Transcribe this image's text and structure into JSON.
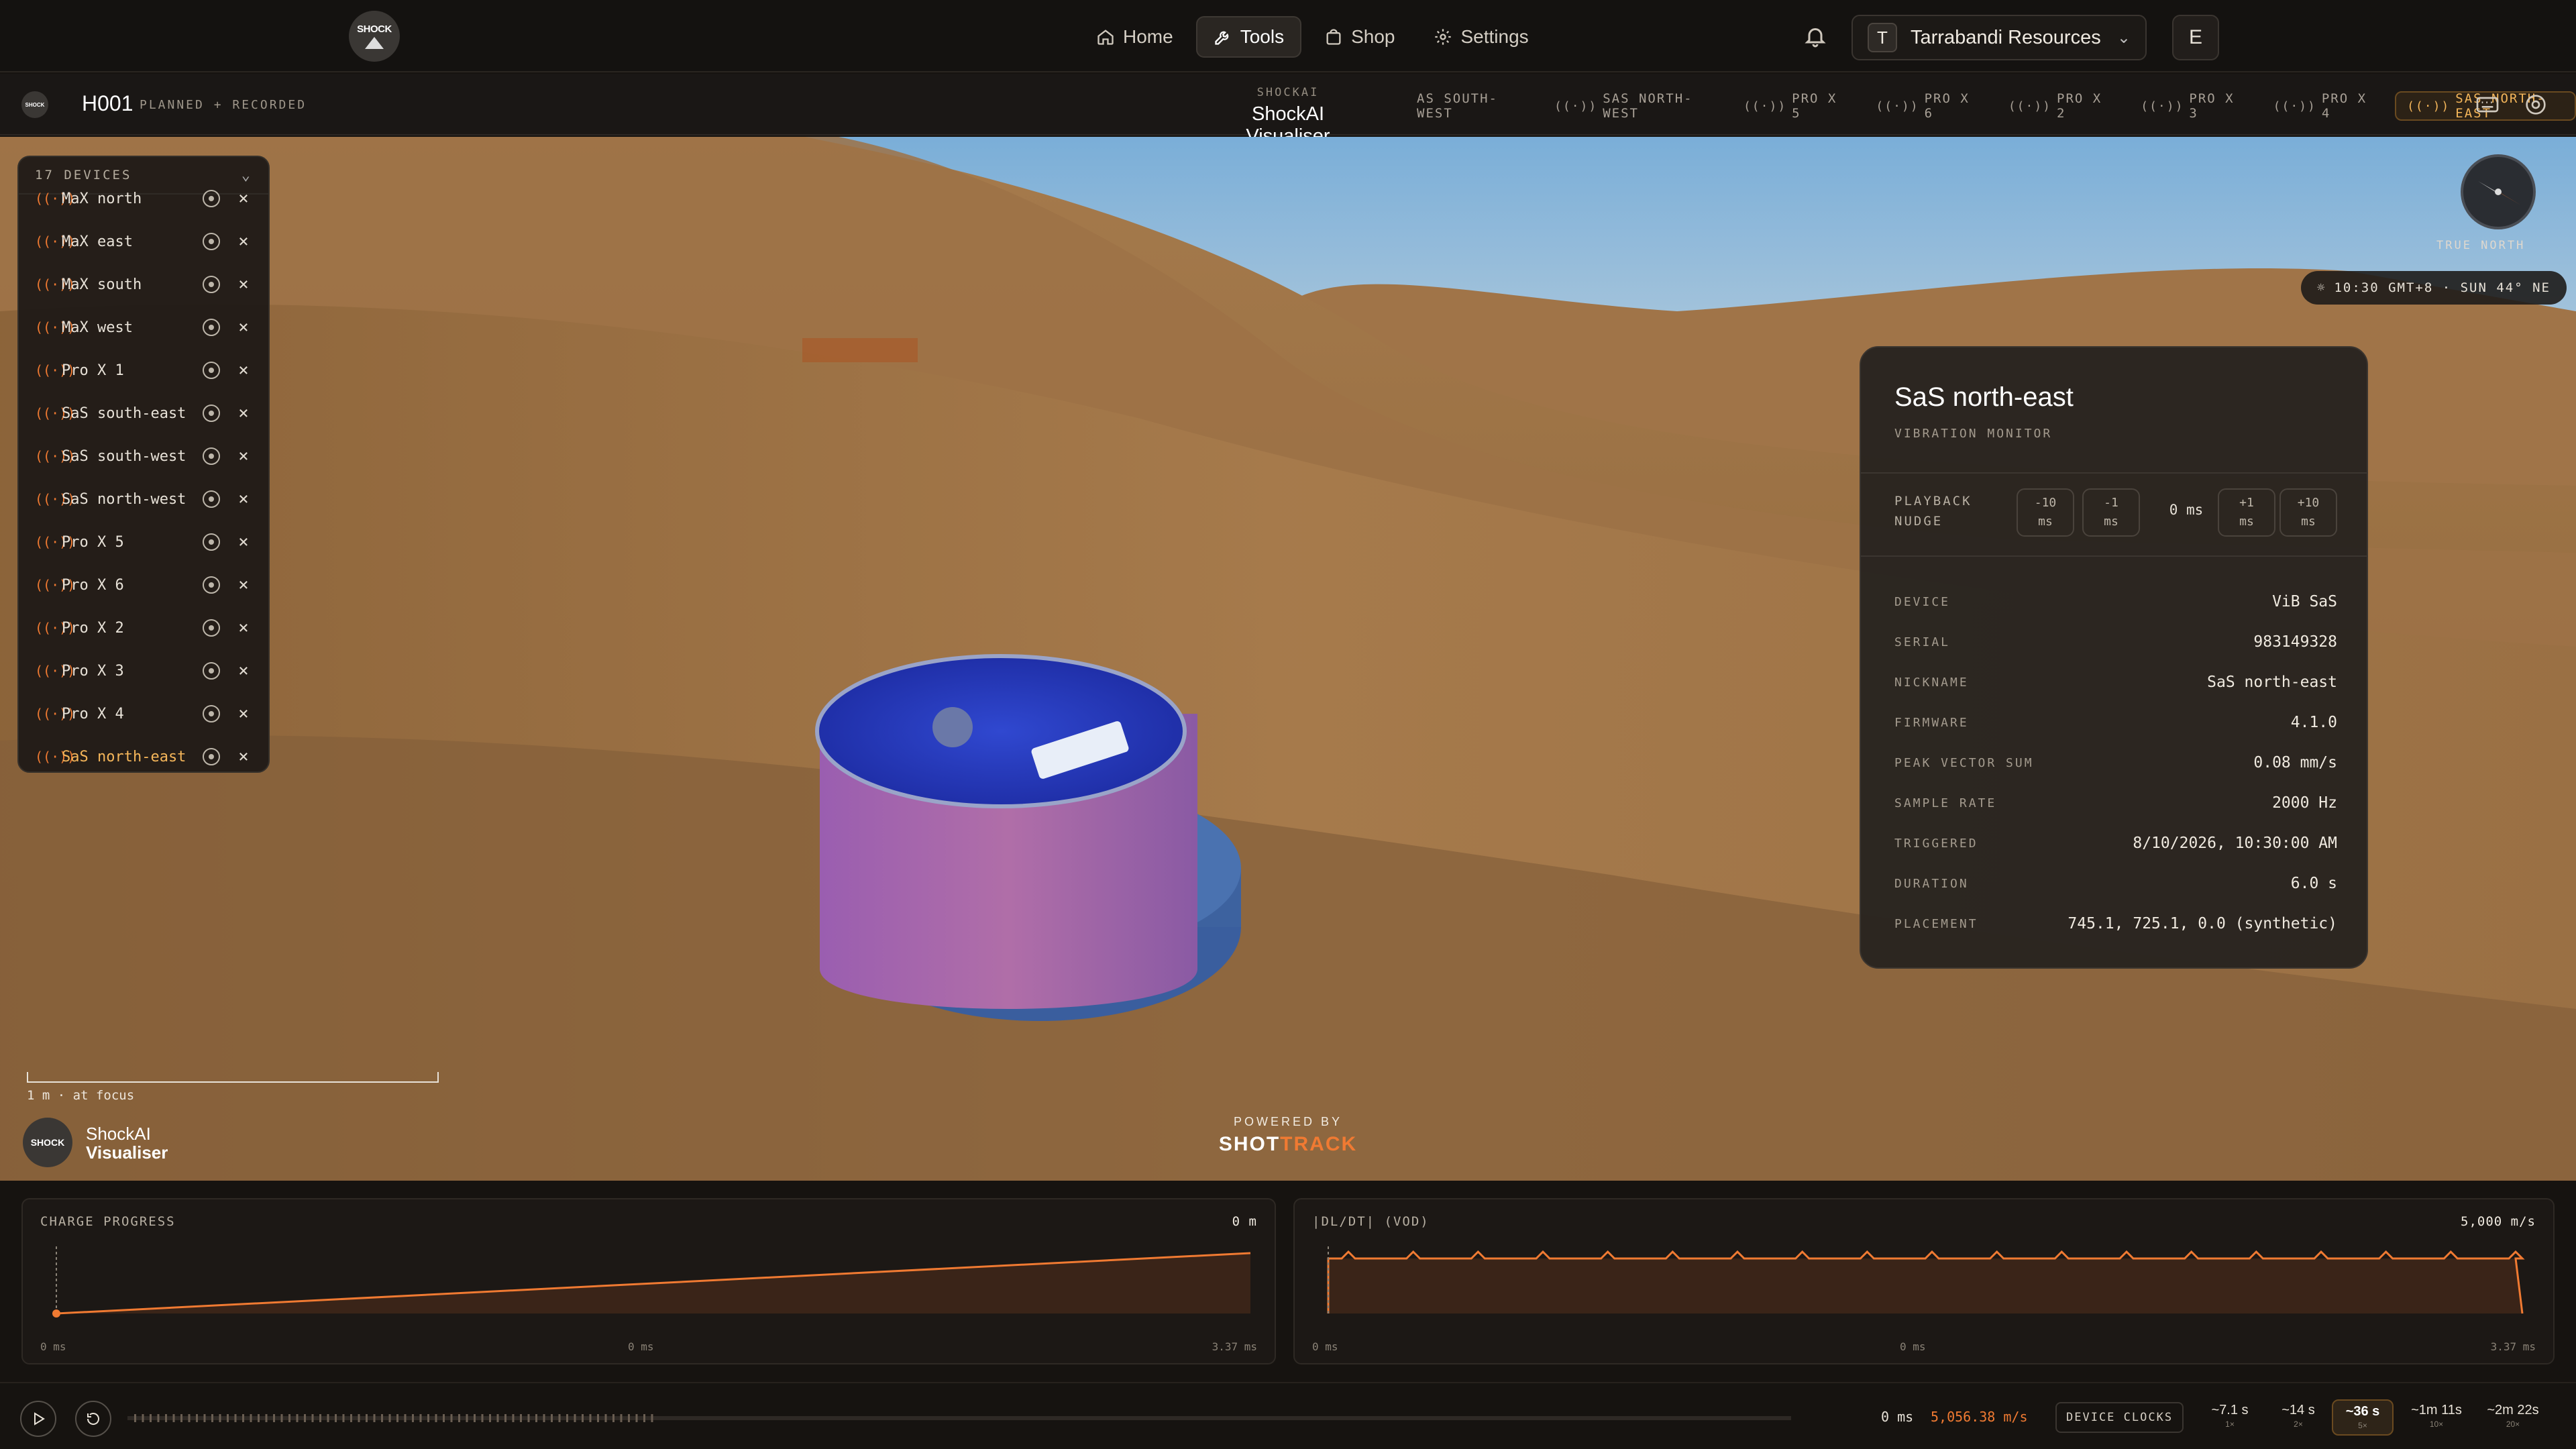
{
  "nav": {
    "logo_text": "SHOCK",
    "links": [
      {
        "label": "Home",
        "icon": "home-icon"
      },
      {
        "label": "Tools",
        "icon": "wrench-icon",
        "active": true
      },
      {
        "label": "Shop",
        "icon": "bag-icon"
      },
      {
        "label": "Settings",
        "icon": "gear-icon"
      }
    ],
    "org": {
      "initial": "T",
      "name": "Tarrabandi Resources"
    },
    "user_initial": "E"
  },
  "subbar": {
    "job_id": "H001",
    "job_status": "PLANNED + RECORDED",
    "app_kicker": "SHOCKAI",
    "app_title": "ShockAI Visualiser",
    "device_tabs": [
      "AS SOUTH-WEST",
      "SAS NORTH-WEST",
      "PRO X 5",
      "PRO X 6",
      "PRO X 2",
      "PRO X 3",
      "PRO X 4",
      "SAS NORTH-EAST"
    ],
    "active_tab": "SAS NORTH-EAST"
  },
  "devices": {
    "header": "17 DEVICES",
    "items": [
      "MaX north",
      "MaX east",
      "MaX south",
      "MaX west",
      "Pro X 1",
      "SaS south-east",
      "SaS south-west",
      "SaS north-west",
      "Pro X 5",
      "Pro X 6",
      "Pro X 2",
      "Pro X 3",
      "Pro X 4",
      "SaS north-east"
    ],
    "active": "SaS north-east"
  },
  "compass": {
    "label": "TRUE NORTH"
  },
  "time_pill": "10:30 GMT+8 · SUN 44° NE",
  "card": {
    "title": "SaS north-east",
    "subtitle": "VIBRATION MONITOR",
    "nudge_label_1": "PLAYBACK",
    "nudge_label_2": "NUDGE",
    "nudge_buttons": [
      {
        "top": "-10",
        "unit": "ms"
      },
      {
        "top": "-1",
        "unit": "ms"
      },
      {
        "top": "+1",
        "unit": "ms"
      },
      {
        "top": "+10",
        "unit": "ms"
      }
    ],
    "nudge_value": "0 ms",
    "fields": [
      {
        "key": "DEVICE",
        "value": "ViB SaS"
      },
      {
        "key": "SERIAL",
        "value": "983149328"
      },
      {
        "key": "NICKNAME",
        "value": "SaS north-east"
      },
      {
        "key": "FIRMWARE",
        "value": "4.1.0"
      },
      {
        "key": "PEAK VECTOR SUM",
        "value": "0.08 mm/s"
      },
      {
        "key": "SAMPLE RATE",
        "value": "2000 Hz"
      },
      {
        "key": "TRIGGERED",
        "value": "8/10/2026, 10:30:00 AM"
      },
      {
        "key": "DURATION",
        "value": "6.0 s"
      },
      {
        "key": "PLACEMENT",
        "value": "745.1, 725.1, 0.0 (synthetic)"
      }
    ]
  },
  "scene": {
    "scale_label": "1 m · at focus",
    "brand_line1": "ShockAI",
    "brand_line2": "Visualiser",
    "powered_by": "POWERED BY",
    "powered_brand_a": "SHOT",
    "powered_brand_b": "TRACK"
  },
  "charts": {
    "charge": {
      "label": "CHARGE PROGRESS",
      "value": "0 m",
      "ticks": [
        "0 ms",
        "0 ms",
        "3.37 ms"
      ]
    },
    "dldt": {
      "label": "|DL/DT| (VOD)",
      "value": "5,000 m/s",
      "ticks": [
        "0 ms",
        "0 ms",
        "3.37 ms"
      ]
    }
  },
  "playback": {
    "time": "0 ms",
    "speed": "5,056.38 m/s",
    "clocks_label": "DEVICE CLOCKS",
    "speeds": [
      {
        "a": "~7.1 s",
        "b": "1×"
      },
      {
        "a": "~14 s",
        "b": "2×"
      },
      {
        "a": "~36 s",
        "b": "5×",
        "active": true
      },
      {
        "a": "~1m 11s",
        "b": "10×"
      },
      {
        "a": "~2m 22s",
        "b": "20×"
      }
    ]
  },
  "colors": {
    "accent": "#f07a32",
    "active_tab": "#f5b65a",
    "bg": "#161310"
  }
}
